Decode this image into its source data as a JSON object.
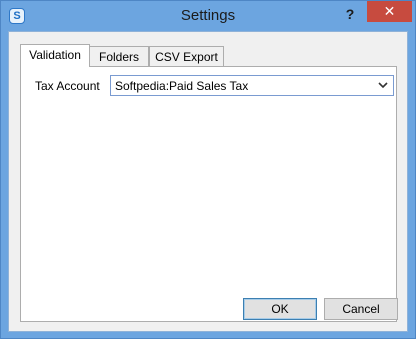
{
  "window": {
    "title": "Settings",
    "help_glyph": "?",
    "close_glyph": "✕",
    "app_icon_letter": "S"
  },
  "tabs": [
    {
      "label": "Validation",
      "active": true
    },
    {
      "label": "Folders",
      "active": false
    },
    {
      "label": "CSV Export",
      "active": false
    }
  ],
  "validation": {
    "tax_account_label": "Tax Account",
    "tax_account_value": "Softpedia:Paid Sales Tax"
  },
  "buttons": {
    "ok_label": "OK",
    "cancel_label": "Cancel"
  },
  "colors": {
    "titlebar": "#6ca5e0",
    "close": "#c74b3f",
    "panel": "#f0f0f0"
  },
  "icons": [
    "app-icon",
    "help-icon",
    "close-icon",
    "chevron-down-icon"
  ]
}
